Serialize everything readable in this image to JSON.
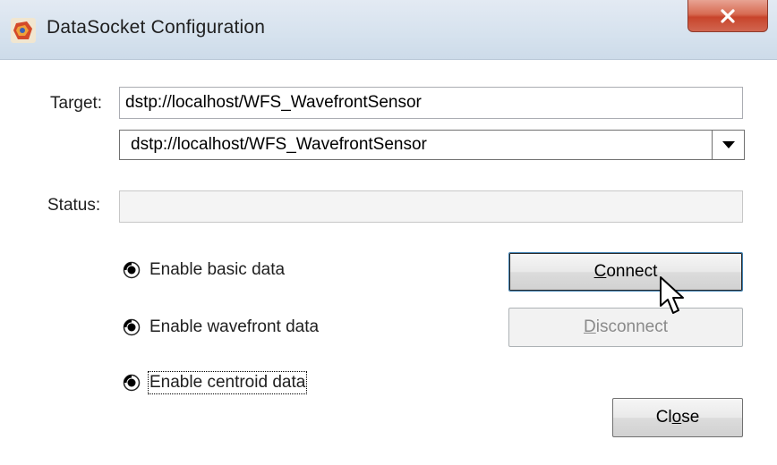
{
  "window": {
    "title": "DataSocket Configuration",
    "app_icon": "labview-icon",
    "close_icon": "close-icon"
  },
  "target": {
    "label": "Target:",
    "value": "dstp://localhost/WFS_WavefrontSensor",
    "dropdown_selected": "dstp://localhost/WFS_WavefrontSensor"
  },
  "status": {
    "label": "Status:",
    "value": ""
  },
  "options": [
    {
      "label": "Enable basic data",
      "selected": true
    },
    {
      "label": "Enable wavefront data",
      "selected": true
    },
    {
      "label": "Enable centroid data",
      "selected": true
    }
  ],
  "buttons": {
    "connect": {
      "mnemonic": "C",
      "rest": "onnect",
      "enabled": true
    },
    "disconnect": {
      "mnemonic": "D",
      "rest": "isconnect",
      "enabled": false
    },
    "close": {
      "pre": "Cl",
      "mnemonic": "o",
      "rest": "se",
      "enabled": true
    }
  },
  "colors": {
    "titlebar": "#d6e2ee",
    "close_button": "#c8442b",
    "disabled_text": "#8a8a8a"
  }
}
